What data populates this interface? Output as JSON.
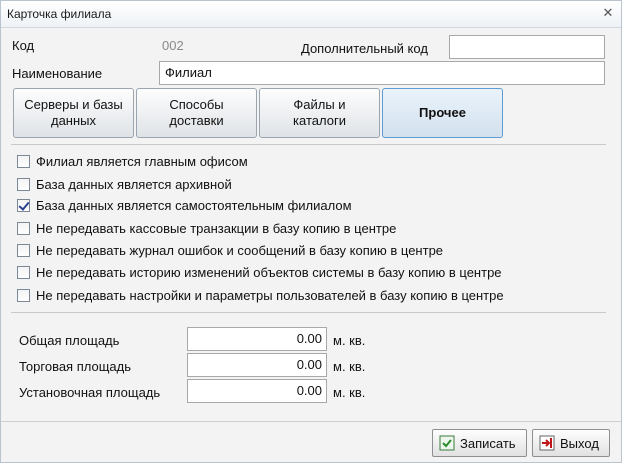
{
  "window": {
    "title": "Карточка филиала",
    "close_glyph": "✕"
  },
  "header": {
    "code_label": "Код",
    "code_value": "002",
    "extra_code_label": "Дополнительный код",
    "extra_code_value": "",
    "name_label": "Наименование",
    "name_value": "Филиал"
  },
  "tabs": [
    {
      "label": "Серверы и базы\nданных",
      "active": false
    },
    {
      "label": "Способы\nдоставки",
      "active": false
    },
    {
      "label": "Файлы и\nкаталоги",
      "active": false
    },
    {
      "label": "Прочее",
      "active": true
    }
  ],
  "options": [
    {
      "label": "Филиал является главным офисом",
      "checked": false
    },
    {
      "label": "База данных является архивной",
      "checked": false
    },
    {
      "label": "База данных является самостоятельным филиалом",
      "checked": true
    },
    {
      "label": "Не передавать кассовые транзакции в базу копию в центре",
      "checked": false
    },
    {
      "label": "Не передавать журнал ошибок и сообщений в базу копию в центре",
      "checked": false
    },
    {
      "label": "Не передавать историю изменений объектов системы в базу копию в центре",
      "checked": false
    },
    {
      "label": "Не передавать настройки и параметры пользователей в базу копию в центре",
      "checked": false
    }
  ],
  "areas": [
    {
      "label": "Общая площадь",
      "value": "0.00",
      "unit": "м. кв."
    },
    {
      "label": "Торговая площадь",
      "value": "0.00",
      "unit": "м. кв."
    },
    {
      "label": "Установочная площадь",
      "value": "0.00",
      "unit": "м. кв."
    }
  ],
  "buttons": {
    "save_label": "Записать",
    "save_icon": "save-record-icon",
    "exit_label": "Выход",
    "exit_icon": "exit-door-icon"
  }
}
